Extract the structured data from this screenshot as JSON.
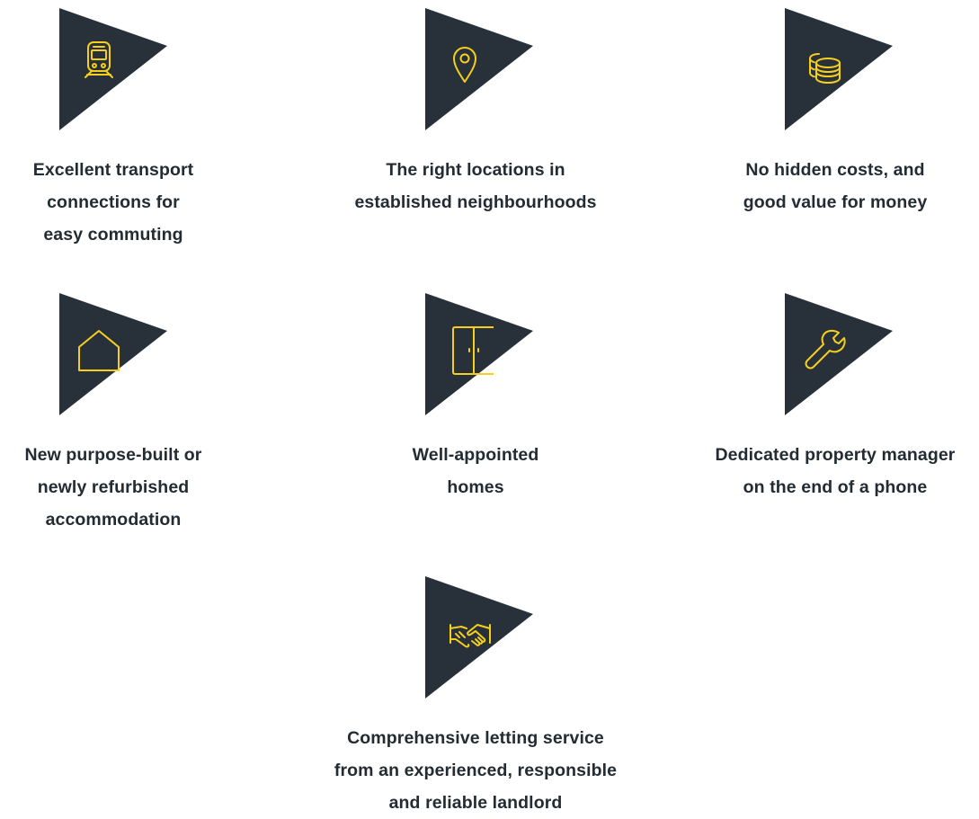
{
  "colors": {
    "badge": "#28303a",
    "icon_stroke": "#f5cf1c",
    "text": "#232b33"
  },
  "features": [
    {
      "icon": "train-icon",
      "lines": [
        "Excellent transport",
        "connections for",
        "easy commuting"
      ]
    },
    {
      "icon": "map-pin-icon",
      "lines": [
        "The right locations in",
        "established neighbourhoods"
      ]
    },
    {
      "icon": "coins-stack-icon",
      "lines": [
        "No hidden costs, and",
        "good  value for money"
      ]
    },
    {
      "icon": "house-icon",
      "lines": [
        "New purpose-built or",
        "newly refurbished",
        "accommodation"
      ]
    },
    {
      "icon": "wardrobe-icon",
      "lines": [
        "Well-appointed",
        "homes"
      ]
    },
    {
      "icon": "wrench-icon",
      "lines": [
        "Dedicated property manager",
        "on the end of a phone"
      ]
    },
    {
      "icon": "handshake-icon",
      "lines": [
        "Comprehensive letting service",
        "from an experienced, responsible",
        "and reliable landlord"
      ]
    }
  ]
}
